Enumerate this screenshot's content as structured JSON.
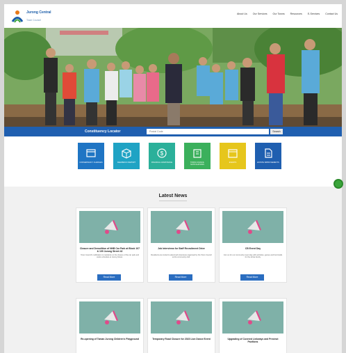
{
  "header": {
    "logo_title": "Jurong Central",
    "logo_subtitle": "Town Council",
    "nav": [
      "About Us",
      "Our Services",
      "Our Towns",
      "Resources",
      "E-Services",
      "Contact Us"
    ]
  },
  "search_band": {
    "label": "Constituency Locator",
    "placeholder": "Postal Code",
    "button": "Search"
  },
  "tiles": [
    {
      "label": "Conservancy Charges",
      "color": "#1f75c4",
      "icon": "card-icon"
    },
    {
      "label": "Feedback/ Report",
      "color": "#1fa3c4",
      "icon": "box-icon"
    },
    {
      "label": "Financial Assistance",
      "color": "#2bb09a",
      "icon": "dollar-icon"
    },
    {
      "label": "Town Council Notifications",
      "color": "#3bb05c",
      "icon": "building-icon"
    },
    {
      "label": "Events",
      "color": "#e6c61c",
      "icon": "calendar-icon"
    },
    {
      "label": "Estate Improvements",
      "color": "#1f5fb0",
      "icon": "document-icon"
    }
  ],
  "news": {
    "title": "Latest News",
    "read_more": "Read More",
    "cards": [
      {
        "title": "Closure and Demolition of NHB Car Park at Block 107 & 109 Jurong Street 42",
        "text": "Town Council's notification to residents on the closure of the car park and works schedule at Jurong Street."
      },
      {
        "title": "Job Interviews for Staff Recruitment Drive",
        "text": "Residents are invited to attend job interviews organised by the Town Council at the community club."
      },
      {
        "title": "CB Event Day",
        "text": "Join us for our community event day with activities, games and food stalls for the whole family."
      },
      {
        "title": "Re-opening of Taman Jurong Children's Playground",
        "text": ""
      },
      {
        "title": "Temporary Road Closure for 2023 Lion Dance Event",
        "text": ""
      },
      {
        "title": "Upgrading of Covered Linkways and Precinct Pavilions",
        "text": ""
      }
    ]
  }
}
